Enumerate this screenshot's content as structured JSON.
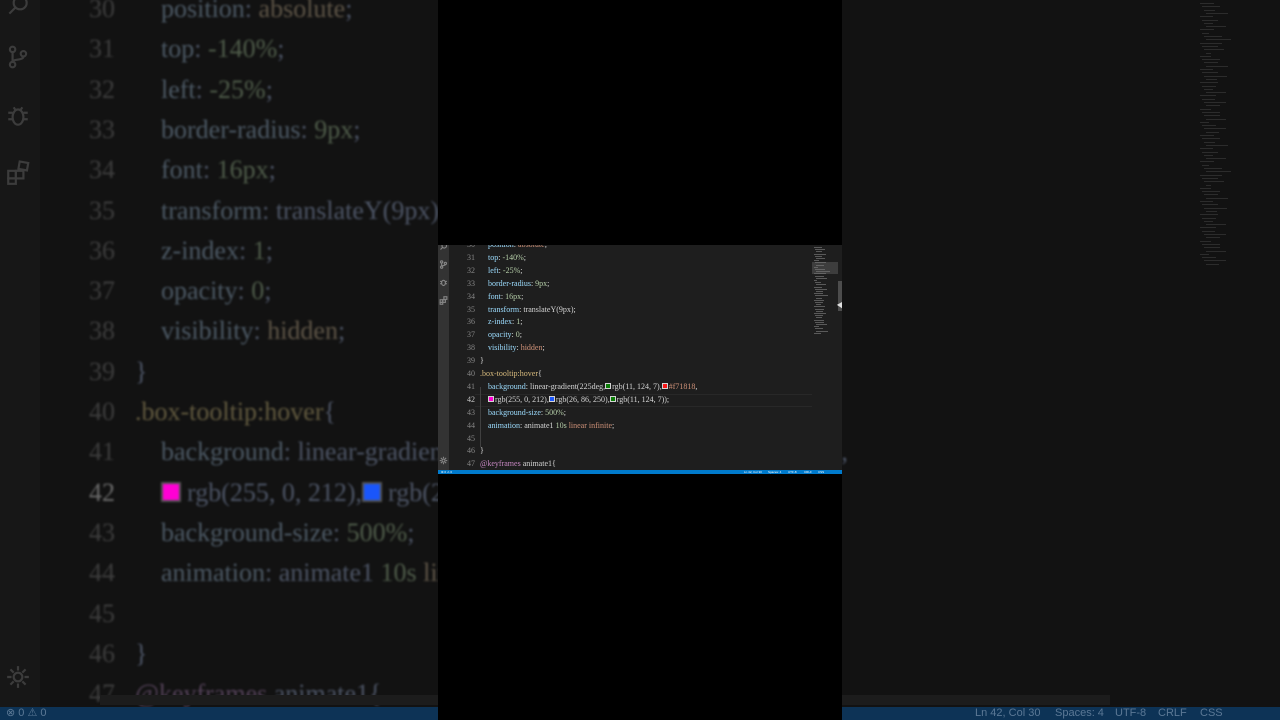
{
  "colors": {
    "editor_bg": "#1e1e1e",
    "status_bar": "#007acc",
    "property": "#9cdcfe",
    "value_string": "#ce9178",
    "number": "#b5cea8",
    "selector": "#d7ba7d",
    "at_rule": "#c586c0"
  },
  "activity_icons": [
    "search-icon",
    "source-control-icon",
    "debug-icon",
    "extensions-icon",
    "gear-icon"
  ],
  "editor": {
    "active_line": "42",
    "line_numbers": [
      "30",
      "31",
      "32",
      "33",
      "34",
      "35",
      "36",
      "37",
      "38",
      "39",
      "40",
      "41",
      "42",
      "43",
      "44",
      "45",
      "46",
      "47"
    ],
    "lines": [
      {
        "indent": "    ",
        "prop": "position",
        "sep": ": ",
        "val": "absolute",
        "end": ";"
      },
      {
        "indent": "    ",
        "prop": "top",
        "sep": ": ",
        "val": "-140%",
        "end": ";"
      },
      {
        "indent": "    ",
        "prop": "left",
        "sep": ": ",
        "val": "-25%",
        "end": ";"
      },
      {
        "indent": "    ",
        "prop": "border-radius",
        "sep": ": ",
        "val": "9px",
        "end": ";"
      },
      {
        "indent": "    ",
        "prop": "font",
        "sep": ": ",
        "val": "16px",
        "end": ";"
      },
      {
        "indent": "    ",
        "prop": "transform",
        "sep": ": ",
        "val": "translateY(9px)",
        "end": ";"
      },
      {
        "indent": "    ",
        "prop": "z-index",
        "sep": ": ",
        "val": "1",
        "end": ";"
      },
      {
        "indent": "    ",
        "prop": "opacity",
        "sep": ": ",
        "val": "0",
        "end": ";"
      },
      {
        "indent": "    ",
        "prop": "visibility",
        "sep": ": ",
        "val": "hidden",
        "end": ";"
      },
      {
        "text": "}"
      },
      {
        "selector": ".box-tooltip:hover",
        "brace": "{"
      },
      {
        "indent": "    ",
        "prop": "background",
        "sep": ": ",
        "fn": "linear-gradient(225deg,",
        "c1": "rgb(11, 124, 7),",
        "c2": "#f71818",
        "end": ","
      },
      {
        "indent": "    ",
        "c3": "rgb(255, 0, 212),",
        "c4": "rgb(26, 86, 250),",
        "c5": "rgb(11, 124, 7));"
      },
      {
        "indent": "    ",
        "prop": "background-size",
        "sep": ": ",
        "val": "500%",
        "end": ";"
      },
      {
        "indent": "    ",
        "prop": "animation",
        "sep": ": ",
        "name": "animate1",
        "val": "10s",
        "kw": "linear infinite",
        "end": ";"
      },
      {
        "text": ""
      },
      {
        "text": "}"
      },
      {
        "at": "@keyframes",
        "name": "animate1",
        "brace": "{"
      }
    ],
    "swatches": {
      "green": "#0b7c07",
      "red": "#f71818",
      "magenta": "#ff00d4",
      "blue": "#1a56fa"
    }
  },
  "status_bar": {
    "left": "⊗ 0 ⚠ 0",
    "position": "Ln 42, Col 30",
    "spaces": "Spaces: 4",
    "encoding": "UTF-8",
    "eol": "CRLF",
    "language": "CSS"
  }
}
